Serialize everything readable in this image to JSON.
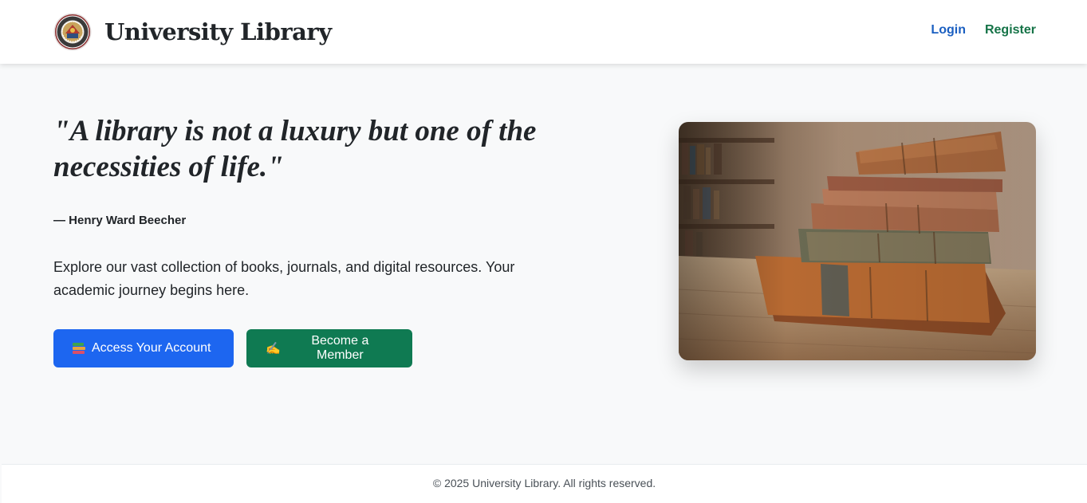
{
  "header": {
    "brand_name": "University Library",
    "nav": {
      "login_label": "Login",
      "register_label": "Register"
    }
  },
  "hero": {
    "quote": "\"A library is not a luxury but one of the necessities of life.\"",
    "author": "— Henry Ward Beecher",
    "description": "Explore our vast collection of books, journals, and digital resources. Your academic journey begins here.",
    "buttons": {
      "access": {
        "icon": "books-emoji",
        "label": "Access Your Account"
      },
      "member": {
        "icon": "✍️",
        "label": "Become a Member"
      }
    },
    "image_icon": "stack-of-old-books-photo"
  },
  "footer": {
    "copyright": "© 2025 University Library. All rights reserved."
  },
  "colors": {
    "primary": "#1d66f0",
    "success": "#0f7a52",
    "link_login": "#1b5fc1",
    "link_register": "#157347",
    "page_bg": "#f8f9fa"
  }
}
